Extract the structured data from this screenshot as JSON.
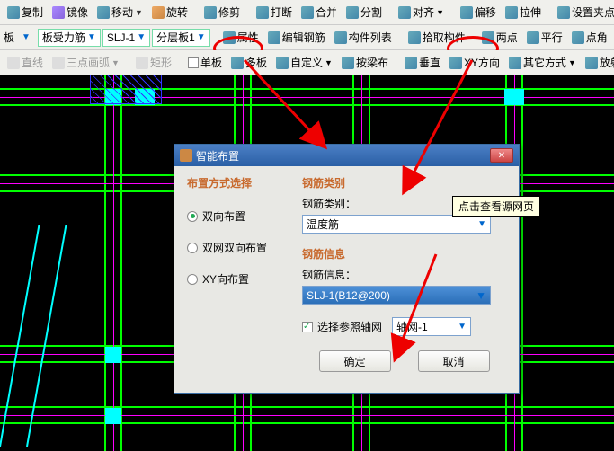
{
  "toolbars": {
    "row1": {
      "copy": "复制",
      "mirror": "镜像",
      "move": "移动",
      "rotate": "旋转",
      "trim": "修剪",
      "break": "打断",
      "merge": "合并",
      "split": "分割",
      "align": "对齐",
      "offset": "偏移",
      "stretch": "拉伸",
      "grip": "设置夹点"
    },
    "row2": {
      "left_label": "板",
      "type": "板受力筋",
      "slj": "SLJ-1",
      "layer": "分层板1",
      "attr": "属性",
      "edit_bar": "编辑钢筋",
      "member_list": "构件列表",
      "pick": "拾取构件",
      "two_point": "两点",
      "parallel": "平行",
      "corner": "点角"
    },
    "row3": {
      "line": "直线",
      "arc": "三点画弧",
      "rect": "矩形",
      "single": "单板",
      "multi": "多板",
      "custom": "自定义",
      "tab": "按梁布",
      "vertical": "垂直",
      "xy": "XY方向",
      "other": "其它方式",
      "radial": "放射筋"
    }
  },
  "dialog": {
    "title": "智能布置",
    "group_layout": "布置方式选择",
    "radio1": "双向布置",
    "radio2": "双网双向布置",
    "radio3": "XY向布置",
    "group_kind": "钢筋类别",
    "kind_label": "钢筋类别：",
    "kind_value": "温度筋",
    "group_info": "钢筋信息",
    "info_label": "钢筋信息：",
    "info_value": "SLJ-1(B12@200)",
    "chk_label": "选择参照轴网",
    "axis_value": "轴网-1",
    "ok": "确定",
    "cancel": "取消"
  },
  "tooltip": "点击查看源网页"
}
